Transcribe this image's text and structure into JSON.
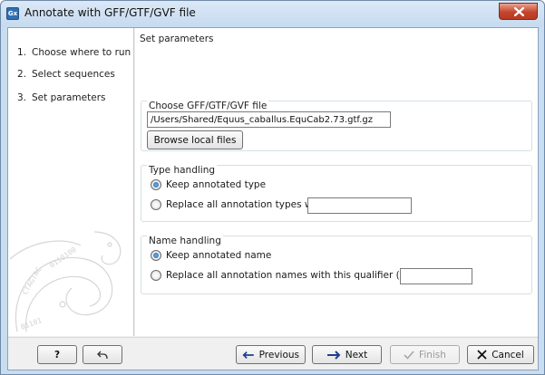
{
  "window": {
    "title": "Annotate with GFF/GTF/GVF file",
    "app_icon_text": "Gx"
  },
  "steps": [
    {
      "num": "1.",
      "label": "Choose where to run"
    },
    {
      "num": "2.",
      "label": "Select sequences"
    },
    {
      "num": "3.",
      "label": "Set parameters"
    }
  ],
  "content": {
    "title": "Set parameters",
    "file_group": {
      "legend": "Choose GFF/GTF/GVF file",
      "path_value": "/Users/Shared/Equus_caballus.EquCab2.73.gtf.gz",
      "browse_label": "Browse local files"
    },
    "type_group": {
      "legend": "Type handling",
      "keep_label": "Keep annotated type",
      "replace_label": "Replace all annotation types with:",
      "replace_value": ""
    },
    "name_group": {
      "legend": "Name handling",
      "keep_label": "Keep annotated name",
      "replace_label": "Replace all annotation names with this qualifier (if exists):",
      "replace_value": ""
    }
  },
  "footer": {
    "help_label": "?",
    "previous_label": "Previous",
    "next_label": "Next",
    "finish_label": "Finish",
    "cancel_label": "Cancel"
  },
  "colors": {
    "title_bar": "#c6dbf0",
    "close_button": "#c4452b",
    "radio_dot": "#1b5fa8",
    "next_arrow": "#1f3f8f",
    "cancel_x": "#111111"
  }
}
